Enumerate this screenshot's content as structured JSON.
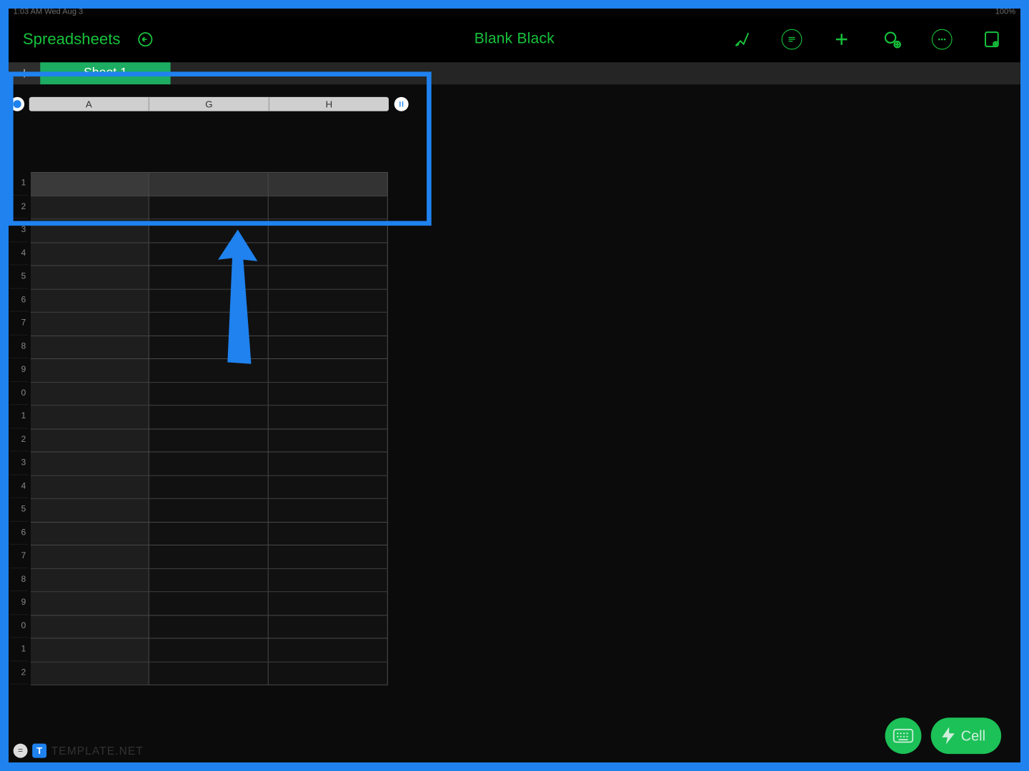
{
  "statusbar": {
    "left": "1:03 AM   Wed Aug 3",
    "right": "100%"
  },
  "toolbar": {
    "back_label": "Spreadsheets",
    "title": "Blank Black"
  },
  "tabs": {
    "active": "Sheet 1"
  },
  "columns": [
    "A",
    "G",
    "H"
  ],
  "rows": [
    "1",
    "2",
    "3",
    "4",
    "5",
    "6",
    "7",
    "8",
    "9",
    "0",
    "1",
    "2",
    "3",
    "4",
    "5",
    "6",
    "7",
    "8",
    "9",
    "0",
    "1",
    "2"
  ],
  "bottom": {
    "fx": "=",
    "t": "T",
    "template": "TEMPLATE.NET"
  },
  "fab": {
    "cell_label": "Cell"
  },
  "icons": {
    "undo": "undo-icon",
    "brush": "brush-icon",
    "format": "format-icon",
    "plus": "plus-icon",
    "share": "share-icon",
    "more": "more-icon",
    "save": "save-icon",
    "keyboard": "keyboard-icon",
    "bolt": "bolt-icon",
    "pause": "pause-icon"
  }
}
